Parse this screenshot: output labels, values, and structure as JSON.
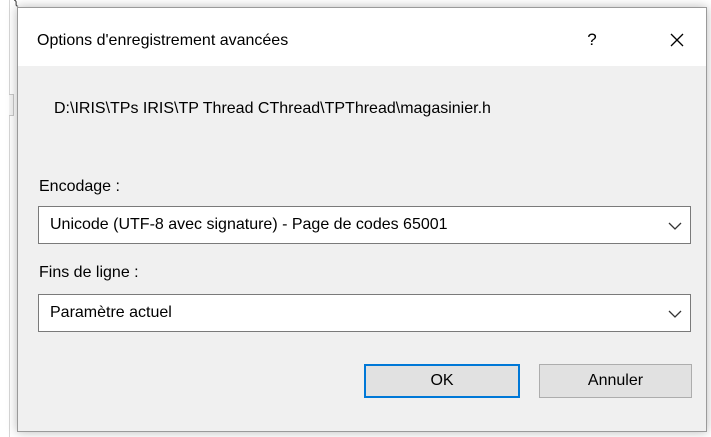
{
  "dialog": {
    "title": "Options d'enregistrement avancées",
    "help_label": "?",
    "file_path": "D:\\IRIS\\TPs IRIS\\TP Thread CThread\\TPThread\\magasinier.h"
  },
  "encoding": {
    "label": "Encodage :",
    "selected": "Unicode (UTF-8 avec signature) - Page de codes 65001"
  },
  "line_endings": {
    "label": "Fins de ligne :",
    "selected": "Paramètre actuel"
  },
  "buttons": {
    "ok": "OK",
    "cancel": "Annuler"
  },
  "background": {
    "glyph": "{"
  },
  "colors": {
    "dialog_bg": "#f0f0f0",
    "accent": "#0078d7",
    "button_bg": "#e1e1e1"
  },
  "icons": {
    "close": "close-icon",
    "dropdown": "chevron-down-icon"
  }
}
